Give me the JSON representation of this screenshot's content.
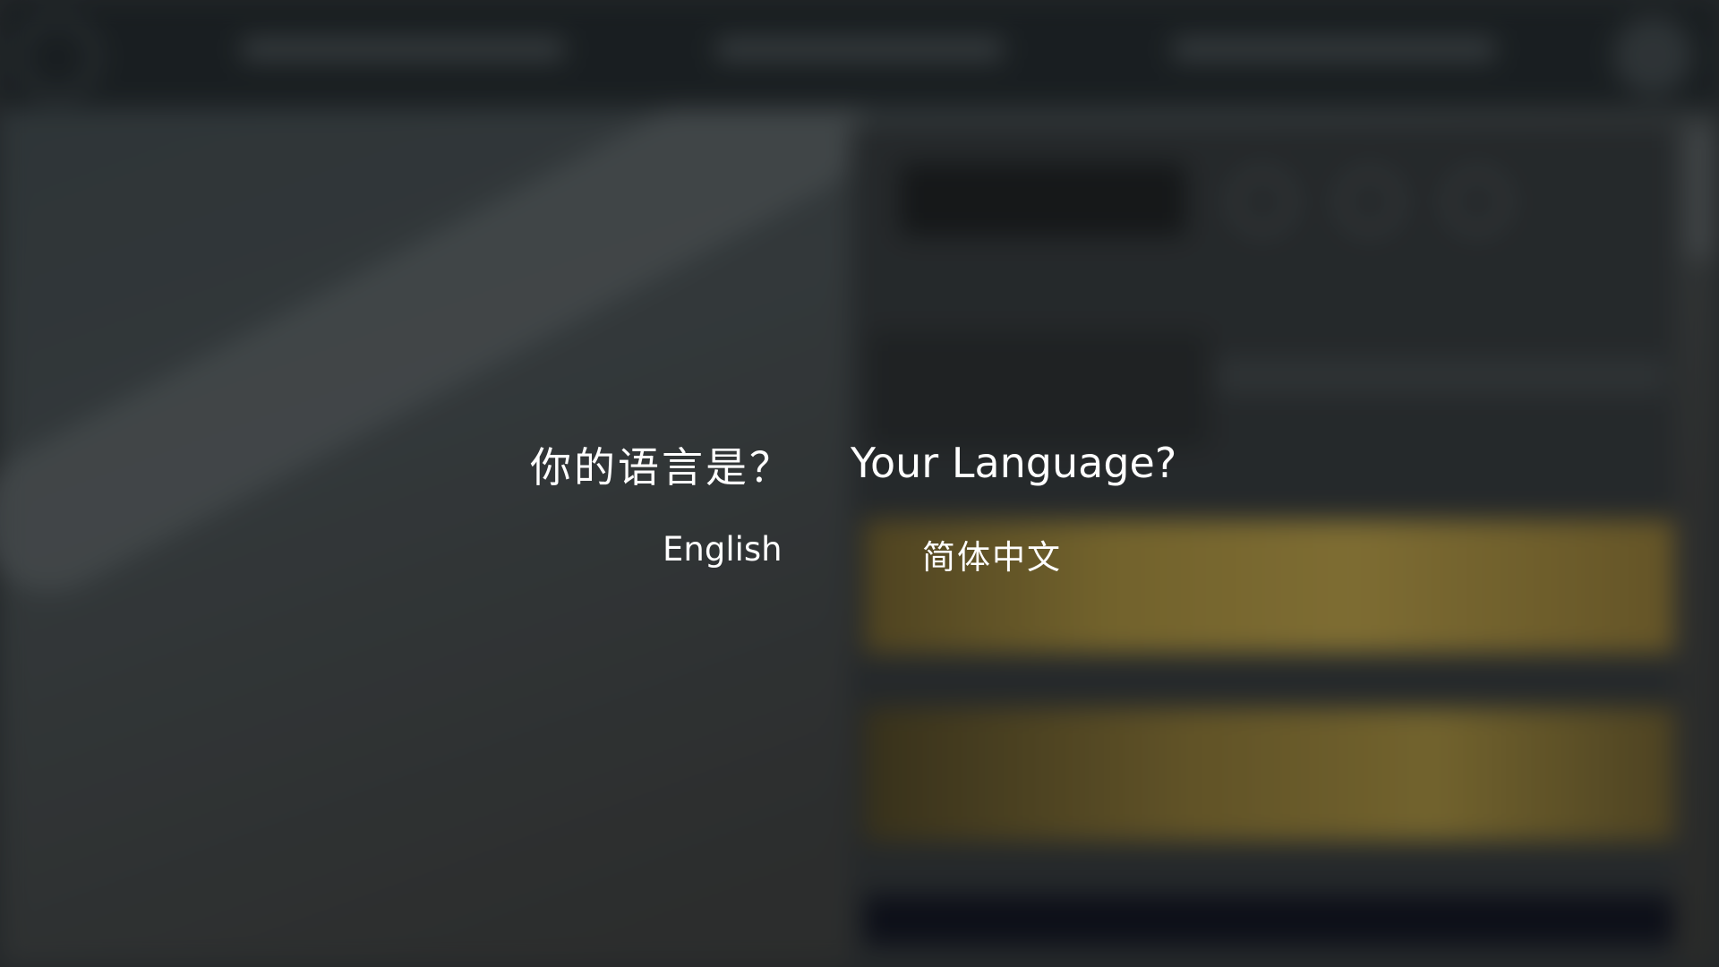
{
  "language_prompt": {
    "question_zh": "你的语言是？",
    "question_en": "Your Language?",
    "options": [
      {
        "label": "English"
      },
      {
        "label": "简体中文"
      }
    ]
  },
  "colors": {
    "overlay_text": "#ffffff",
    "background_dim": "#2c3033"
  }
}
